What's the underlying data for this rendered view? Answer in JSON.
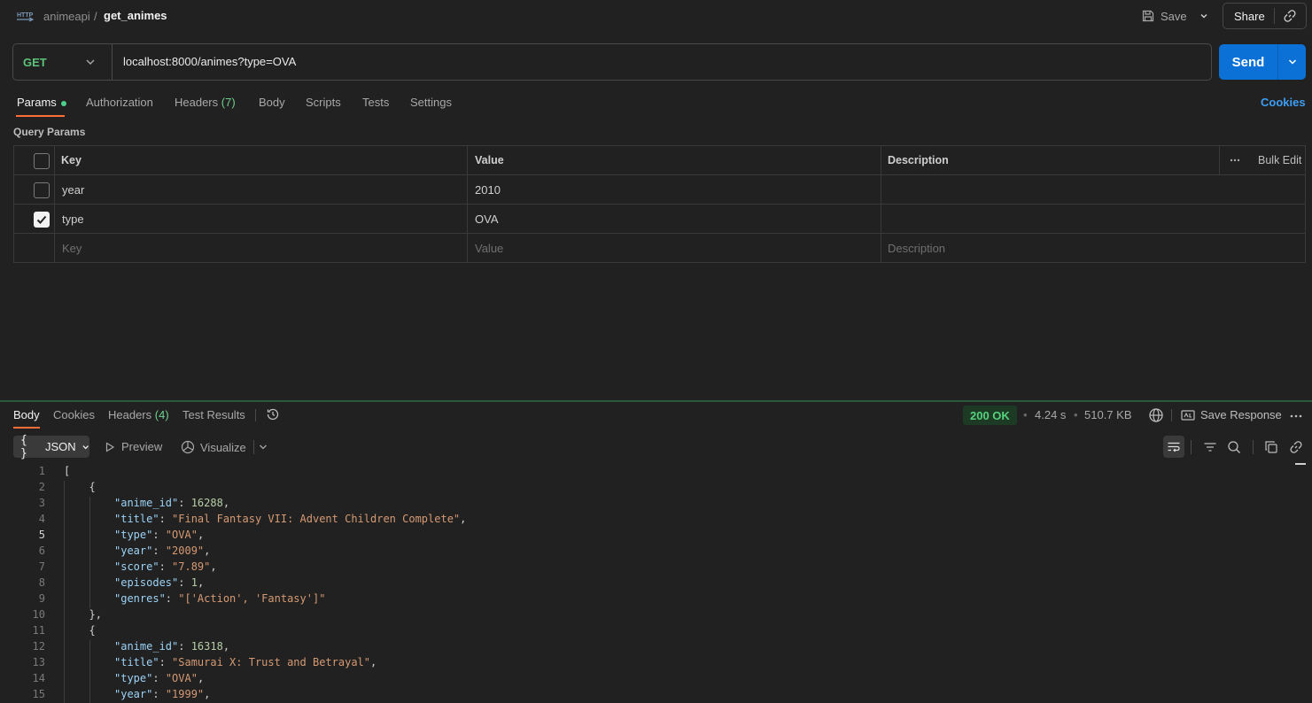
{
  "breadcrumb": {
    "collection": "animeapi",
    "separator": "/",
    "request": "get_animes"
  },
  "header": {
    "save_label": "Save",
    "share_label": "Share"
  },
  "request": {
    "method": "GET",
    "url": "localhost:8000/animes?type=OVA",
    "send_label": "Send"
  },
  "request_tabs": [
    {
      "label": "Params"
    },
    {
      "label": "Authorization"
    },
    {
      "label": "Headers",
      "count": "(7)"
    },
    {
      "label": "Body"
    },
    {
      "label": "Scripts"
    },
    {
      "label": "Tests"
    },
    {
      "label": "Settings"
    }
  ],
  "cookies_label": "Cookies",
  "query_params": {
    "title": "Query Params",
    "headers": {
      "key": "Key",
      "value": "Value",
      "description": "Description",
      "bulk_edit": "Bulk Edit"
    },
    "rows": [
      {
        "key": "year",
        "value": "2010",
        "description": "",
        "checked": false
      },
      {
        "key": "type",
        "value": "OVA",
        "description": "",
        "checked": true
      }
    ],
    "placeholders": {
      "key": "Key",
      "value": "Value",
      "description": "Description"
    }
  },
  "response_tabs": [
    {
      "label": "Body"
    },
    {
      "label": "Cookies"
    },
    {
      "label": "Headers",
      "count": "(4)"
    },
    {
      "label": "Test Results"
    }
  ],
  "response": {
    "status": "200 OK",
    "time": "4.24 s",
    "size": "510.7 KB",
    "save_label": "Save Response",
    "dot": "•"
  },
  "body_toolbar": {
    "format": "JSON",
    "preview": "Preview",
    "visualize": "Visualize"
  },
  "code_lines": [
    {
      "n": "1",
      "indent": 0,
      "html": "["
    },
    {
      "n": "2",
      "indent": 1,
      "html": "{"
    },
    {
      "n": "3",
      "indent": 2,
      "key": "anime_id",
      "num": "16288",
      "end": ","
    },
    {
      "n": "4",
      "indent": 2,
      "key": "title",
      "str": "Final Fantasy VII: Advent Children Complete",
      "end": ","
    },
    {
      "n": "5",
      "indent": 2,
      "key": "type",
      "str": "OVA",
      "end": ","
    },
    {
      "n": "6",
      "indent": 2,
      "key": "year",
      "str": "2009",
      "end": ","
    },
    {
      "n": "7",
      "indent": 2,
      "key": "score",
      "str": "7.89",
      "end": ","
    },
    {
      "n": "8",
      "indent": 2,
      "key": "episodes",
      "num": "1",
      "end": ","
    },
    {
      "n": "9",
      "indent": 2,
      "key": "genres",
      "str": "['Action', 'Fantasy']",
      "end": ""
    },
    {
      "n": "10",
      "indent": 1,
      "html": "},"
    },
    {
      "n": "11",
      "indent": 1,
      "html": "{"
    },
    {
      "n": "12",
      "indent": 2,
      "key": "anime_id",
      "num": "16318",
      "end": ","
    },
    {
      "n": "13",
      "indent": 2,
      "key": "title",
      "str": "Samurai X: Trust and Betrayal",
      "end": ","
    },
    {
      "n": "14",
      "indent": 2,
      "key": "type",
      "str": "OVA",
      "end": ","
    },
    {
      "n": "15",
      "indent": 2,
      "key": "year",
      "str": "1999",
      "end": ","
    }
  ],
  "current_line": "5"
}
